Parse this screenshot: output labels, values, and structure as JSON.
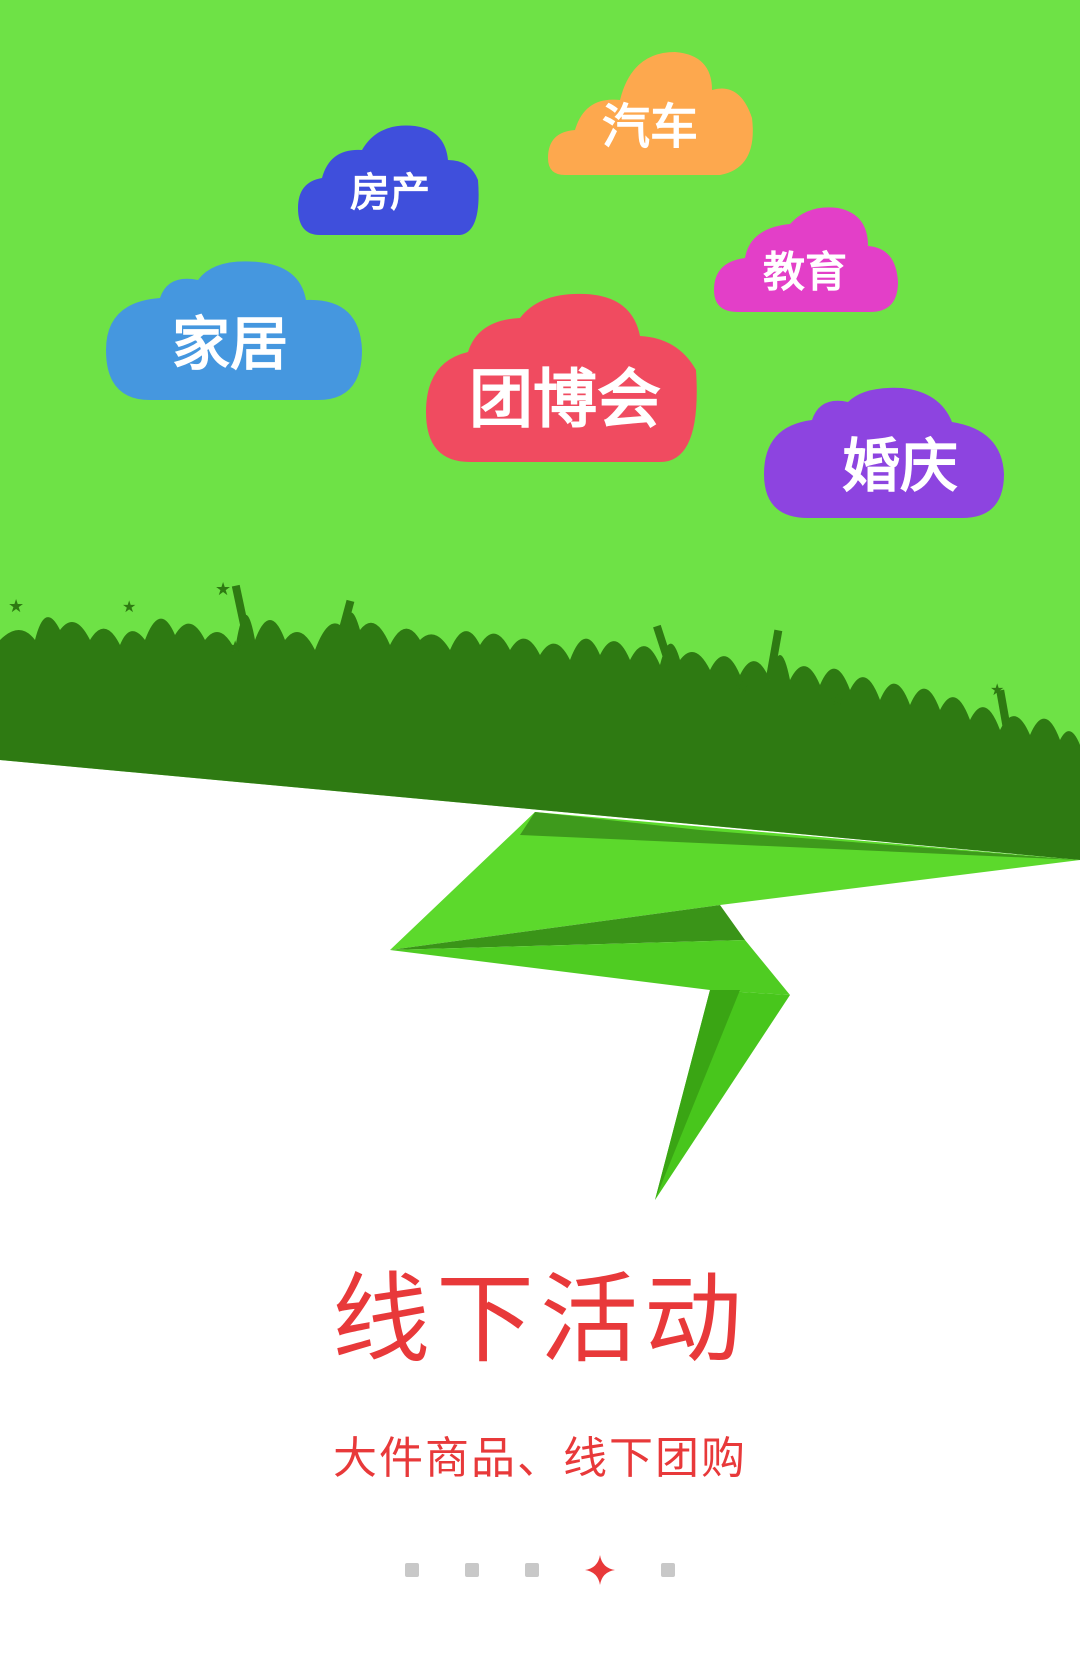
{
  "clouds": [
    {
      "label": "汽车",
      "color": "#fda84e"
    },
    {
      "label": "房产",
      "color": "#3f4fdc"
    },
    {
      "label": "教育",
      "color": "#e33fc8"
    },
    {
      "label": "家居",
      "color": "#4597df"
    },
    {
      "label": "团博会",
      "color": "#f04b60"
    },
    {
      "label": "婚庆",
      "color": "#8d44e0"
    }
  ],
  "colors": {
    "top_green": "#6ee246",
    "crowd_green": "#2e7a12",
    "fold_green": "#4fcc22",
    "accent_red": "#e8393a",
    "dot_gray": "#c8c8c8"
  },
  "title": "线下活动",
  "subtitle": "大件商品、线下团购",
  "pager": {
    "total": 5,
    "active_index": 3
  }
}
